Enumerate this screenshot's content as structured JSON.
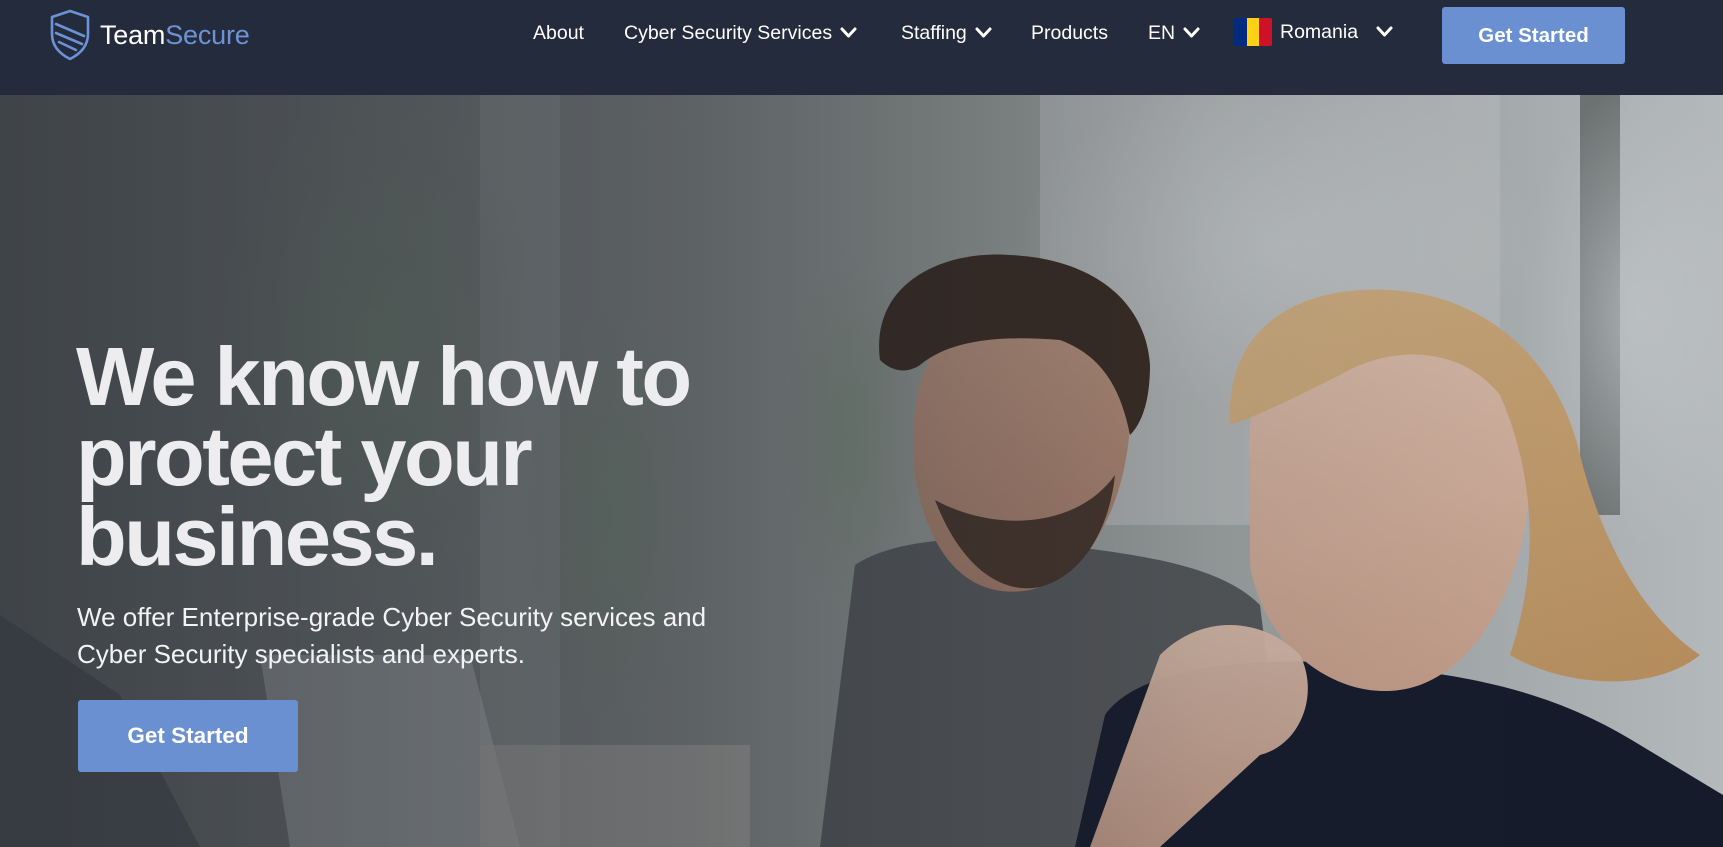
{
  "brand": {
    "name_part1": "Team",
    "name_part2": "Secure"
  },
  "nav": {
    "items": [
      {
        "label": "About",
        "has_dropdown": false
      },
      {
        "label": "Cyber Security Services",
        "has_dropdown": true
      },
      {
        "label": "Staffing",
        "has_dropdown": true
      },
      {
        "label": "Products",
        "has_dropdown": false
      }
    ],
    "language": {
      "label": "EN",
      "icon": "chevron-down-icon"
    },
    "country": {
      "label": "Romania",
      "flag_icon": "romania-flag-icon",
      "flag_colors": [
        "#002b7f",
        "#fcd116",
        "#ce1126"
      ]
    },
    "cta_label": "Get Started"
  },
  "hero": {
    "title_lines": [
      "We know how to",
      "protect your",
      "business."
    ],
    "subtitle_lines": [
      "We offer Enterprise-grade Cyber Security services and",
      "Cyber Security specialists and experts."
    ],
    "cta_label": "Get Started",
    "background_image": "photo-two-people-smiling-at-laptop"
  },
  "colors": {
    "nav_bg": "#242b3c",
    "accent": "#6a90d1",
    "logo_accent": "#6b93d6",
    "text": "#ffffff"
  }
}
